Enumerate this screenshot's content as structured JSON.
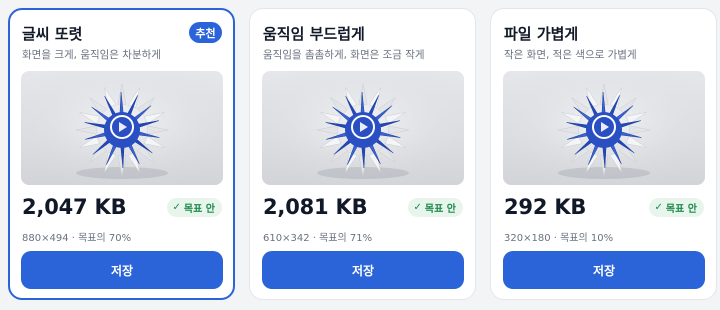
{
  "options": [
    {
      "title": "글씨 또렷",
      "badge": "추천",
      "subtitle": "화면을 크게, 움직임은 차분하게",
      "size": "2,047 KB",
      "status": "목표 안",
      "meta": "880×494 · 목표의 70%",
      "save_label": "저장",
      "selected": true
    },
    {
      "title": "움직임 부드럽게",
      "subtitle": "움직임을 촘촘하게, 화면은 조금 작게",
      "size": "2,081 KB",
      "status": "목표 안",
      "meta": "610×342 · 목표의 71%",
      "save_label": "저장",
      "selected": false
    },
    {
      "title": "파일 가볍게",
      "subtitle": "작은 화면, 적은 색으로 가볍게",
      "size": "292 KB",
      "status": "목표 안",
      "meta": "320×180 · 목표의 10%",
      "save_label": "저장",
      "selected": false
    }
  ],
  "colors": {
    "accent": "#2b63d9",
    "status_bg": "#e8f5ec",
    "status_text": "#1f8a4c"
  },
  "icons": {
    "status": "check-icon",
    "preview_overlay": "play-icon"
  }
}
